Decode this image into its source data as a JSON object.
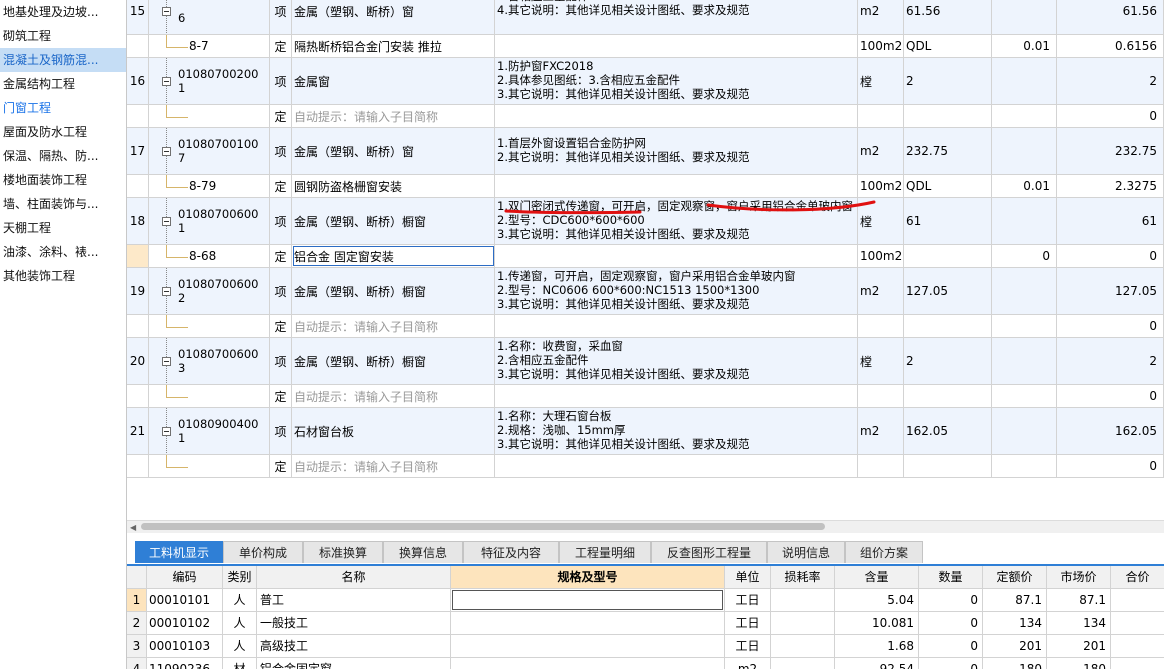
{
  "sidebar": {
    "items": [
      {
        "label": "地基处理及边坡..."
      },
      {
        "label": "砌筑工程"
      },
      {
        "label": "混凝土及钢筋混..."
      },
      {
        "label": "金属结构工程"
      },
      {
        "label": "门窗工程"
      },
      {
        "label": "屋面及防水工程"
      },
      {
        "label": "保温、隔热、防..."
      },
      {
        "label": "楼地面装饰工程"
      },
      {
        "label": "墙、柱面装饰与..."
      },
      {
        "label": "天棚工程"
      },
      {
        "label": "油漆、涂料、裱..."
      },
      {
        "label": "其他装饰工程"
      }
    ]
  },
  "grid": {
    "rows": [
      {
        "kind": "item",
        "seq": "15",
        "code1": "",
        "code2": "6",
        "type": "项",
        "name": "金属（塑钢、断桥）窗",
        "feat": [
          "",
          "3.含相应五金配件",
          "4.其它说明：其他详见相关设计图纸、要求及规范"
        ],
        "unit": "m2",
        "expr": "61.56",
        "content": "",
        "qty": "61.56"
      },
      {
        "kind": "sub",
        "code": "8-7",
        "type": "定",
        "name": "隔热断桥铝合金门安装 推拉",
        "unit": "100m2",
        "expr": "QDL",
        "content": "0.01",
        "qty": "0.6156"
      },
      {
        "kind": "item",
        "seq": "16",
        "code1": "01080700200",
        "code2": "1",
        "type": "项",
        "name": "金属窗",
        "feat": [
          "1.防护窗FXC2018",
          "2.具体参见图纸：3.含相应五金配件",
          "3.其它说明：其他详见相关设计图纸、要求及规范"
        ],
        "unit": "樘",
        "expr": "2",
        "content": "",
        "qty": "2"
      },
      {
        "kind": "sub",
        "code": "",
        "type": "定",
        "name": "自动提示：请输入子目简称",
        "hint": true,
        "unit": "",
        "expr": "",
        "content": "",
        "qty": "0"
      },
      {
        "kind": "item",
        "seq": "17",
        "code1": "01080700100",
        "code2": "7",
        "type": "项",
        "name": "金属（塑钢、断桥）窗",
        "feat": [
          "1.首层外窗设置铝合金防护网",
          "2.其它说明：其他详见相关设计图纸、要求及规范"
        ],
        "unit": "m2",
        "expr": "232.75",
        "content": "",
        "qty": "232.75"
      },
      {
        "kind": "sub",
        "code": "8-79",
        "type": "定",
        "name": "圆钢防盗格栅窗安装",
        "unit": "100m2",
        "expr": "QDL",
        "content": "0.01",
        "qty": "2.3275"
      },
      {
        "kind": "item",
        "seq": "18",
        "code1": "01080700600",
        "code2": "1",
        "type": "项",
        "name": "金属（塑钢、断桥）橱窗",
        "feat": [
          "1.双门密闭式传递窗，可开启，固定观察窗，窗户采用铝合金单玻内窗",
          "2.型号：CDC600*600*600",
          "3.其它说明：其他详见相关设计图纸、要求及规范"
        ],
        "unit": "樘",
        "expr": "61",
        "content": "",
        "qty": "61"
      },
      {
        "kind": "sub",
        "code": "8-68",
        "type": "定",
        "name": "铝合金 固定窗安装",
        "unit": "100m2",
        "expr": "",
        "content": "0",
        "qty": "0",
        "editing": true
      },
      {
        "kind": "item",
        "seq": "19",
        "code1": "01080700600",
        "code2": "2",
        "type": "项",
        "name": "金属（塑钢、断桥）橱窗",
        "feat": [
          "1.传递窗，可开启，固定观察窗，窗户采用铝合金单玻内窗",
          "2.型号：NC0606 600*600:NC1513 1500*1300",
          "3.其它说明：其他详见相关设计图纸、要求及规范"
        ],
        "unit": "m2",
        "expr": "127.05",
        "content": "",
        "qty": "127.05"
      },
      {
        "kind": "sub",
        "code": "",
        "type": "定",
        "name": "自动提示：请输入子目简称",
        "hint": true,
        "unit": "",
        "expr": "",
        "content": "",
        "qty": "0"
      },
      {
        "kind": "item",
        "seq": "20",
        "code1": "01080700600",
        "code2": "3",
        "type": "项",
        "name": "金属（塑钢、断桥）橱窗",
        "feat": [
          "1.名称：收费窗，采血窗",
          "2.含相应五金配件",
          "3.其它说明：其他详见相关设计图纸、要求及规范"
        ],
        "unit": "樘",
        "expr": "2",
        "content": "",
        "qty": "2"
      },
      {
        "kind": "sub",
        "code": "",
        "type": "定",
        "name": "自动提示：请输入子目简称",
        "hint": true,
        "unit": "",
        "expr": "",
        "content": "",
        "qty": "0"
      },
      {
        "kind": "item",
        "seq": "21",
        "code1": "01080900400",
        "code2": "1",
        "type": "项",
        "name": "石材窗台板",
        "feat": [
          "1.名称：大理石窗台板",
          "2.规格：浅咖、15mm厚",
          "3.其它说明：其他详见相关设计图纸、要求及规范"
        ],
        "unit": "m2",
        "expr": "162.05",
        "content": "",
        "qty": "162.05"
      },
      {
        "kind": "sub",
        "code": "",
        "type": "定",
        "name": "自动提示：请输入子目简称",
        "hint": true,
        "unit": "",
        "expr": "",
        "content": "",
        "qty": "0"
      }
    ]
  },
  "tabs": [
    {
      "label": "工料机显示"
    },
    {
      "label": "单价构成"
    },
    {
      "label": "标准换算"
    },
    {
      "label": "换算信息"
    },
    {
      "label": "特征及内容"
    },
    {
      "label": "工程量明细"
    },
    {
      "label": "反查图形工程量"
    },
    {
      "label": "说明信息"
    },
    {
      "label": "组价方案"
    }
  ],
  "bottom": {
    "headers": {
      "code": "编码",
      "cat": "类别",
      "name": "名称",
      "spec": "规格及型号",
      "unit": "单位",
      "loss": "损耗率",
      "cont": "含量",
      "cnt": "数量",
      "price": "定额价",
      "mkt": "市场价",
      "tot": "合价"
    },
    "rows": [
      {
        "n": "1",
        "code": "00010101",
        "cat": "人",
        "name": "普工",
        "spec": "",
        "unit": "工日",
        "loss": "",
        "cont": "5.04",
        "cnt": "0",
        "price": "87.1",
        "mkt": "87.1",
        "tot": ""
      },
      {
        "n": "2",
        "code": "00010102",
        "cat": "人",
        "name": "一般技工",
        "spec": "",
        "unit": "工日",
        "loss": "",
        "cont": "10.081",
        "cnt": "0",
        "price": "134",
        "mkt": "134",
        "tot": ""
      },
      {
        "n": "3",
        "code": "00010103",
        "cat": "人",
        "name": "高级技工",
        "spec": "",
        "unit": "工日",
        "loss": "",
        "cont": "1.68",
        "cnt": "0",
        "price": "201",
        "mkt": "201",
        "tot": ""
      },
      {
        "n": "4",
        "code": "11090236",
        "cat": "材",
        "name": "铝合金固定窗",
        "spec": "",
        "unit": "m2",
        "loss": "",
        "cont": "92.54",
        "cnt": "0",
        "price": "180",
        "mkt": "180",
        "tot": ""
      }
    ]
  }
}
